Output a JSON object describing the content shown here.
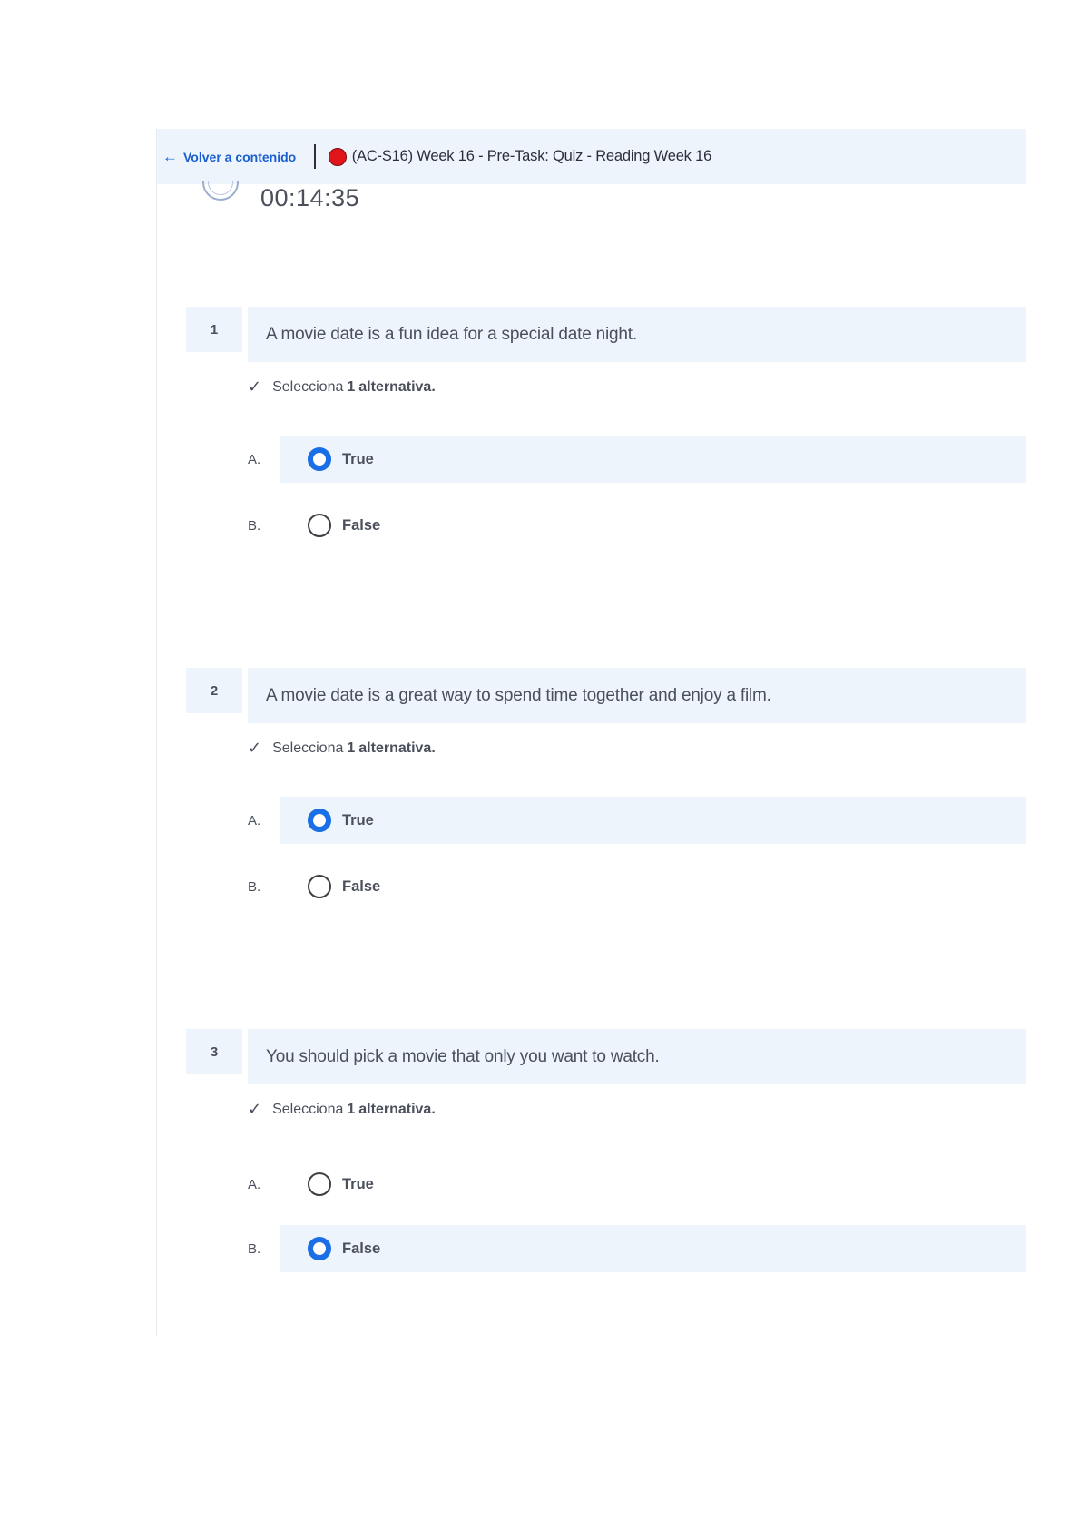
{
  "header": {
    "back_label": "Volver a contenido",
    "title": "(AC-S16) Week 16 - Pre-Task: Quiz - Reading Week 16"
  },
  "timer": {
    "value": "00:14:35"
  },
  "instruction": {
    "prefix": "Selecciona",
    "count": "1",
    "suffix": "alternativa."
  },
  "questions": [
    {
      "number": "1",
      "text": "A movie date is a fun idea for a special date night.",
      "options": [
        {
          "letter": "A.",
          "label": "True",
          "selected": true
        },
        {
          "letter": "B.",
          "label": "False",
          "selected": false
        }
      ]
    },
    {
      "number": "2",
      "text": "A movie date is a great way to spend time together and enjoy a film.",
      "options": [
        {
          "letter": "A.",
          "label": "True",
          "selected": true
        },
        {
          "letter": "B.",
          "label": "False",
          "selected": false
        }
      ]
    },
    {
      "number": "3",
      "text": "You should pick a movie that only you want to watch.",
      "options": [
        {
          "letter": "A.",
          "label": "True",
          "selected": false
        },
        {
          "letter": "B.",
          "label": "False",
          "selected": true
        }
      ]
    }
  ],
  "colors": {
    "accent": "#1a6ee6",
    "panel": "#eef4fc",
    "link": "#1a5fd0",
    "record": "#e0161b"
  }
}
